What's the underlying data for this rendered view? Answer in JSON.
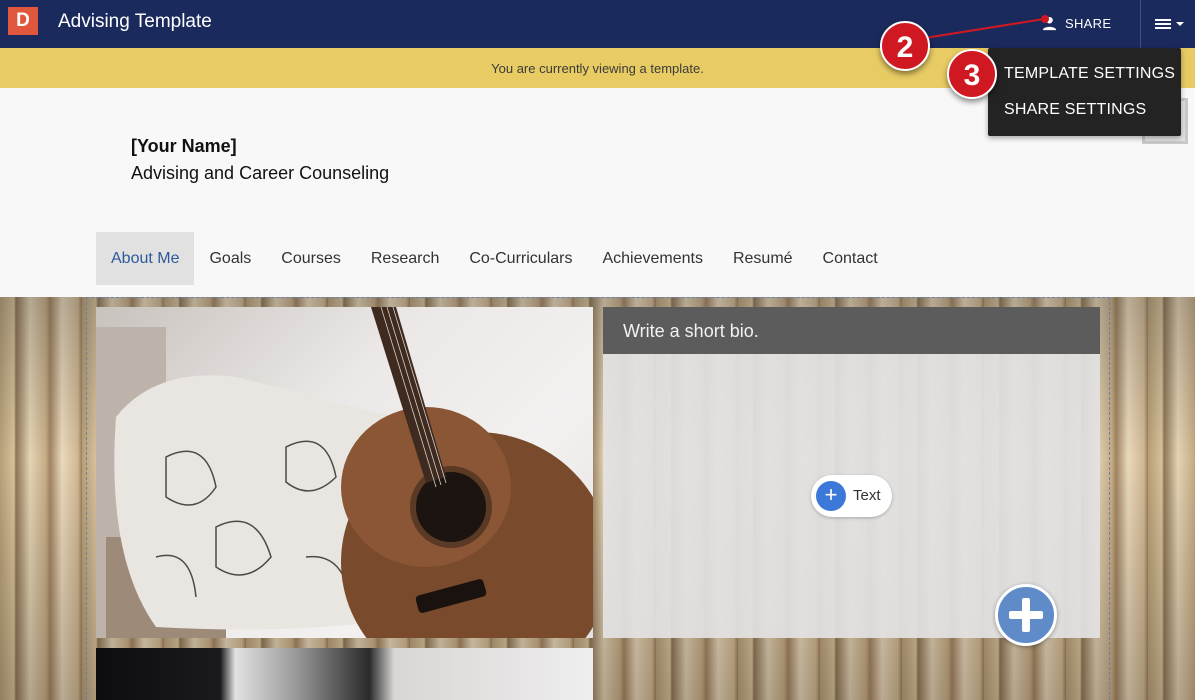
{
  "app": {
    "logo_letter": "D",
    "title": "Advising Template"
  },
  "topbar": {
    "share_label": "SHARE",
    "menu_icon": "hamburger-icon"
  },
  "banner": {
    "text": "You are currently viewing a template."
  },
  "dropdown": {
    "items": [
      {
        "label": "TEMPLATE SETTINGS"
      },
      {
        "label": "SHARE SETTINGS"
      }
    ]
  },
  "callouts": {
    "first": "2",
    "second": "3"
  },
  "site": {
    "name": "[Your Name]",
    "subtitle": "Advising and Career Counseling"
  },
  "nav": {
    "items": [
      {
        "label": "About Me",
        "active": true
      },
      {
        "label": "Goals"
      },
      {
        "label": "Courses"
      },
      {
        "label": "Research"
      },
      {
        "label": "Co-Curriculars"
      },
      {
        "label": "Achievements"
      },
      {
        "label": "Resumé"
      },
      {
        "label": "Contact"
      }
    ]
  },
  "bio": {
    "title": "Write a short bio.",
    "add_text_label": "Text"
  },
  "colors": {
    "topbar": "#1b2a5c",
    "banner": "#e8cb63",
    "callout": "#d01822",
    "accent": "#3c78d8",
    "logo": "#e0573e"
  }
}
